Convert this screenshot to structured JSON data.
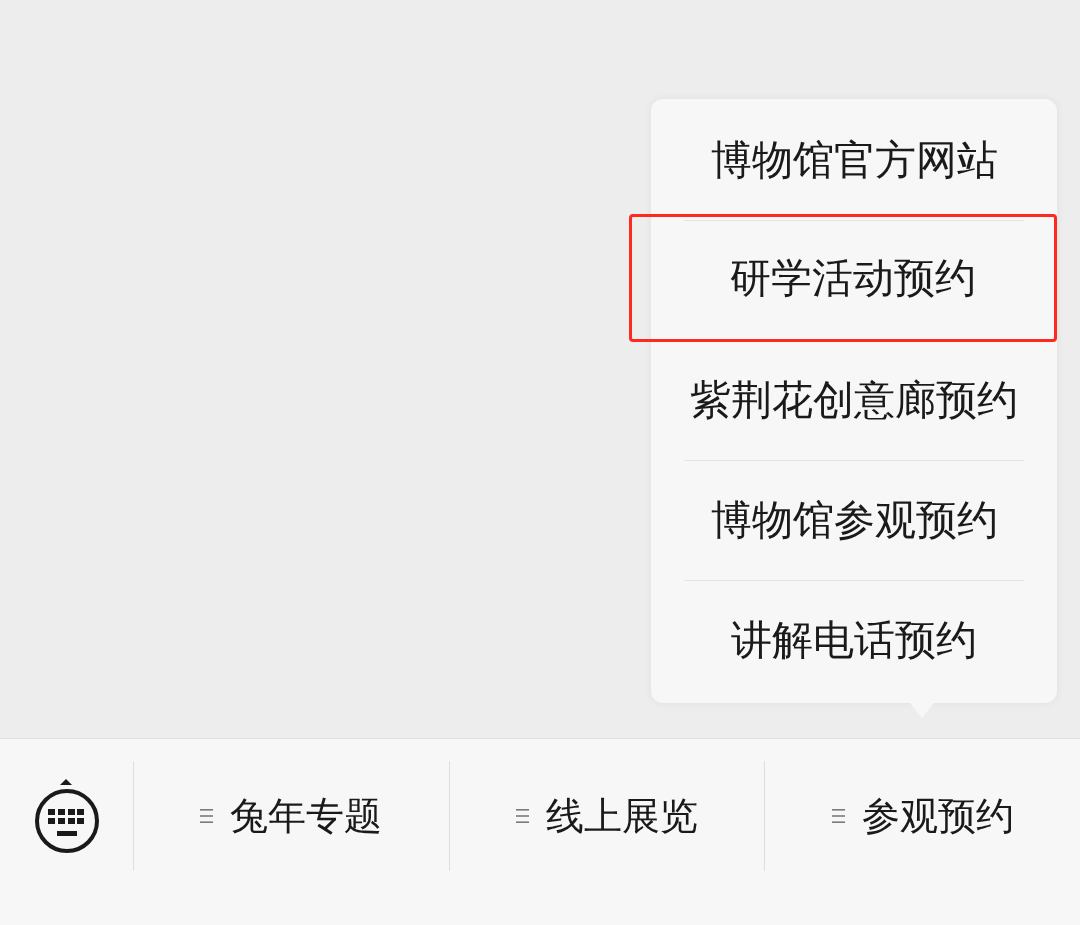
{
  "popup_menu": {
    "items": [
      {
        "label": "博物馆官方网站",
        "highlighted": false
      },
      {
        "label": "研学活动预约",
        "highlighted": true
      },
      {
        "label": "紫荆花创意廊预约",
        "highlighted": false
      },
      {
        "label": "博物馆参观预约",
        "highlighted": false
      },
      {
        "label": "讲解电话预约",
        "highlighted": false
      }
    ]
  },
  "menu_bar": {
    "menus": [
      {
        "label": "兔年专题"
      },
      {
        "label": "线上展览"
      },
      {
        "label": "参观预约"
      }
    ]
  }
}
